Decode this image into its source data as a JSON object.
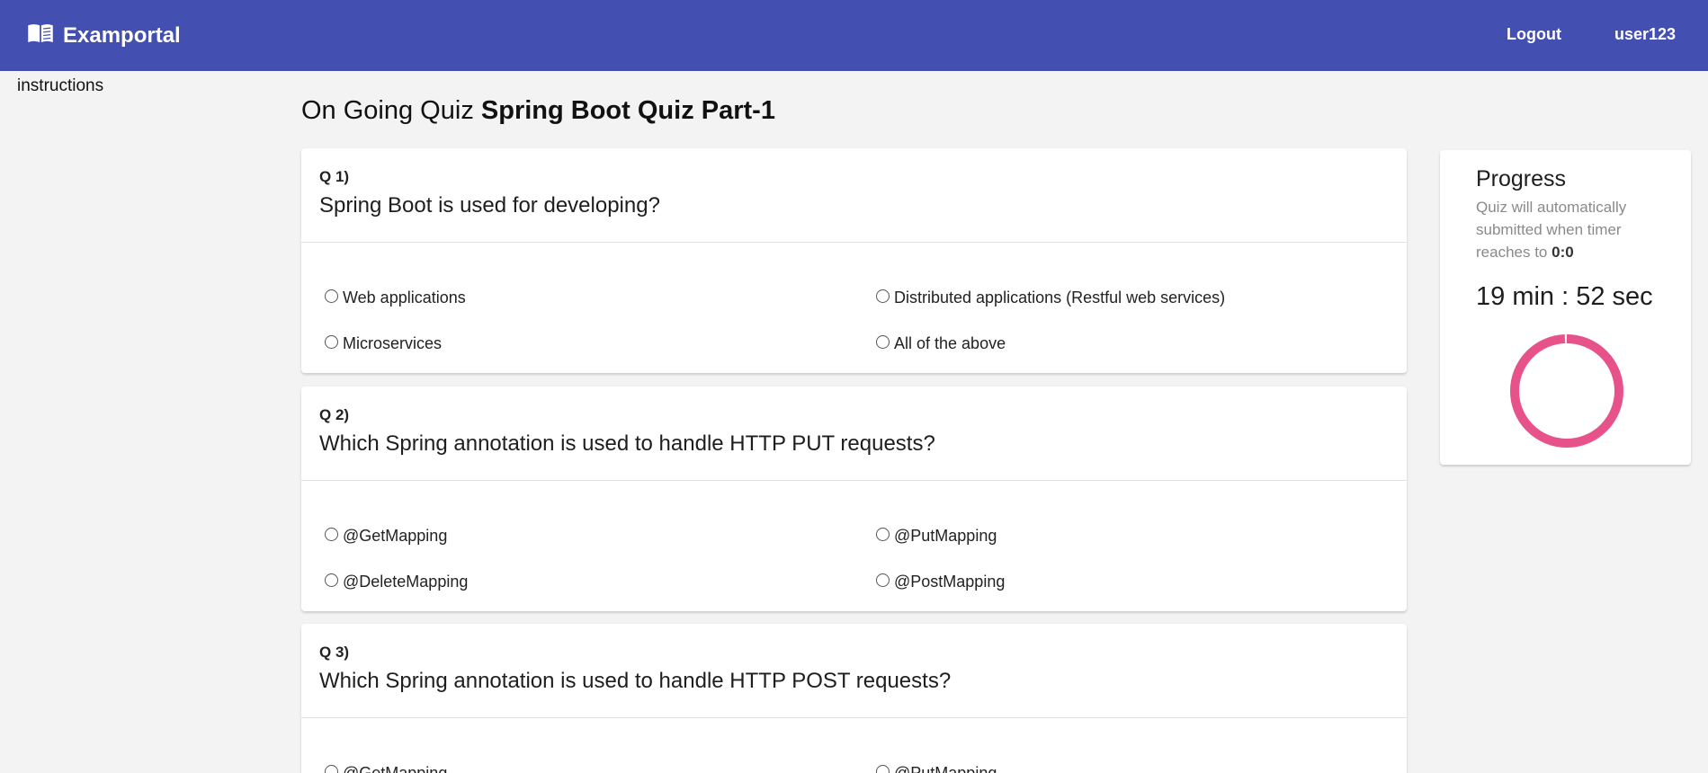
{
  "navbar": {
    "brand_icon": "open-book-icon",
    "brand": "Examportal",
    "logout": "Logout",
    "username": "user123",
    "bg_color": "#4350b1"
  },
  "sidebar": {
    "label": "instructions"
  },
  "page": {
    "title_prefix": "On Going Quiz",
    "quiz_name": "Spring Boot Quiz Part-1"
  },
  "questions": [
    {
      "number": "Q 1)",
      "text": "Spring Boot is used for developing?",
      "options": [
        "Web applications",
        "Distributed applications (Restful web services)",
        "Microservices",
        "All of the above"
      ]
    },
    {
      "number": "Q 2)",
      "text": "Which Spring annotation is used to handle HTTP PUT requests?",
      "options": [
        "@GetMapping",
        "@PutMapping",
        "@DeleteMapping",
        "@PostMapping"
      ]
    },
    {
      "number": "Q 3)",
      "text": "Which Spring annotation is used to handle HTTP POST requests?",
      "options": [
        "@GetMapping",
        "@PutMapping"
      ]
    }
  ],
  "progress": {
    "title": "Progress",
    "note": "Quiz will automatically submitted when timer reaches to",
    "note_value": "0:0",
    "timer": "19 min : 52 sec",
    "remaining_fraction": 0.993,
    "ring_color": "#e8528a"
  }
}
